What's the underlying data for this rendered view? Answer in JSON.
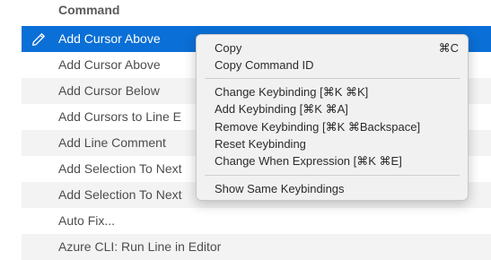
{
  "table": {
    "column_header": "Command",
    "rows": [
      {
        "label": "Add Cursor Above"
      },
      {
        "label": "Add Cursor Above"
      },
      {
        "label": "Add Cursor Below"
      },
      {
        "label": "Add Cursors to Line E"
      },
      {
        "label": "Add Line Comment"
      },
      {
        "label": "Add Selection To Next"
      },
      {
        "label": "Add Selection To Next"
      },
      {
        "label": "Auto Fix..."
      },
      {
        "label": "Azure CLI: Run Line in Editor"
      }
    ]
  },
  "context_menu": {
    "copy": "Copy",
    "copy_shortcut": "⌘C",
    "copy_command_id": "Copy Command ID",
    "change_keybinding": "Change Keybinding [⌘K ⌘K]",
    "add_keybinding": "Add Keybinding [⌘K ⌘A]",
    "remove_keybinding": "Remove Keybinding [⌘K ⌘Backspace]",
    "reset_keybinding": "Reset Keybinding",
    "change_when_expression": "Change When Expression [⌘K ⌘E]",
    "show_same_keybindings": "Show Same Keybindings"
  },
  "colors": {
    "selection": "#0a6fd6",
    "row_alt": "#f3f3f3",
    "menu_bg": "#f1f1f1"
  },
  "icons": {
    "edit": "pencil-icon"
  }
}
